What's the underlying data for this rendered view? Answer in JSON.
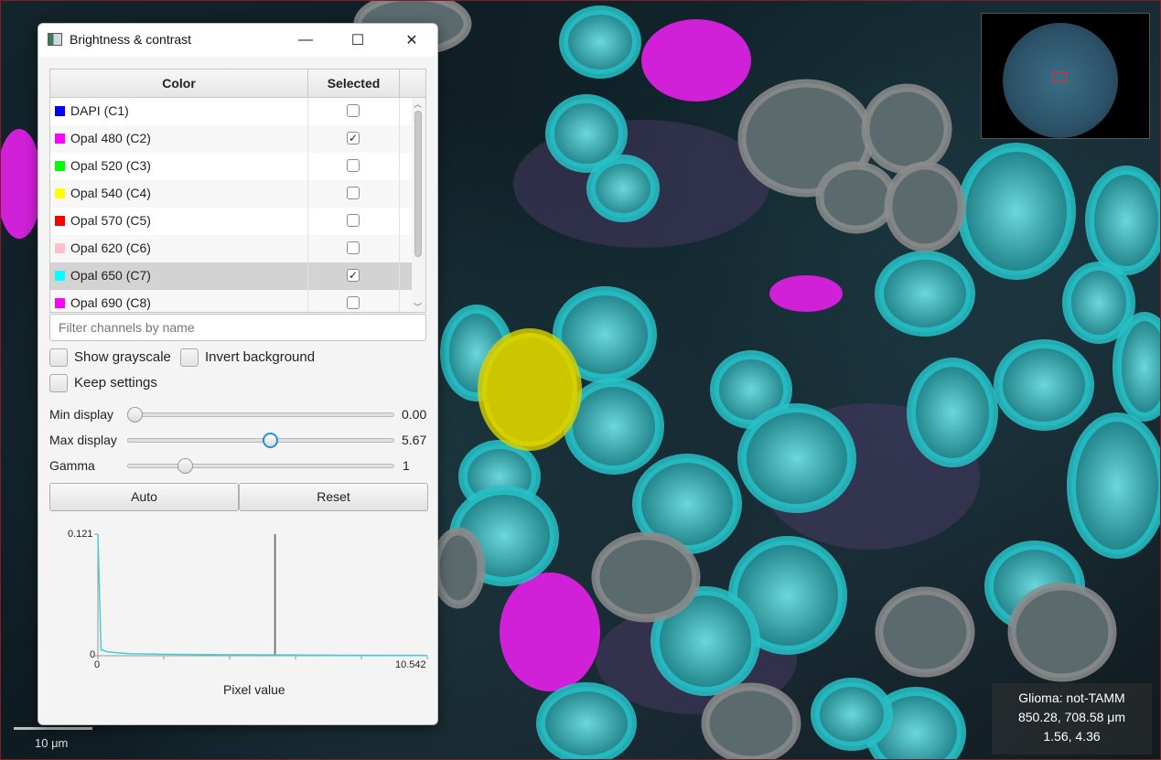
{
  "dialog": {
    "title": "Brightness & contrast",
    "window_controls": {
      "minimize": "—",
      "maximize": "☐",
      "close": "✕"
    },
    "table": {
      "headers": {
        "color": "Color",
        "selected": "Selected"
      },
      "rows": [
        {
          "label": "DAPI (C1)",
          "color": "#0000ff",
          "selected": false
        },
        {
          "label": "Opal 480 (C2)",
          "color": "#ff00ff",
          "selected": true
        },
        {
          "label": "Opal 520 (C3)",
          "color": "#00ff00",
          "selected": false
        },
        {
          "label": "Opal 540 (C4)",
          "color": "#ffff00",
          "selected": false
        },
        {
          "label": "Opal 570 (C5)",
          "color": "#ff0000",
          "selected": false
        },
        {
          "label": "Opal 620 (C6)",
          "color": "#ffc0cb",
          "selected": false
        },
        {
          "label": "Opal 650 (C7)",
          "color": "#00ffff",
          "selected": true,
          "highlighted": true
        },
        {
          "label": "Opal 690 (C8)",
          "color": "#ff00ff",
          "selected": false
        }
      ]
    },
    "filter_placeholder": "Filter channels by name",
    "options": {
      "show_grayscale": "Show grayscale",
      "invert_background": "Invert background",
      "keep_settings": "Keep settings"
    },
    "sliders": {
      "min_display": {
        "label": "Min display",
        "value": "0.00",
        "fraction": 0.0
      },
      "max_display": {
        "label": "Max display",
        "value": "5.67",
        "fraction": 0.538
      },
      "gamma": {
        "label": "Gamma",
        "value": "1",
        "fraction": 0.2
      }
    },
    "buttons": {
      "auto": "Auto",
      "reset": "Reset"
    },
    "histogram": {
      "y_max_label": "0.121",
      "y_min_label": "0",
      "x_min_label": "0",
      "x_max_label": "10.542",
      "xlabel": "Pixel value"
    }
  },
  "viewer": {
    "info": {
      "line1": "Glioma: not-TAMM",
      "line2": "850.28, 708.58 μm",
      "line3": "1.56, 4.36"
    },
    "scalebar_label": "10 μm"
  },
  "chart_data": {
    "type": "line",
    "title": "",
    "xlabel": "Pixel value",
    "ylabel": "",
    "xlim": [
      0,
      10.542
    ],
    "ylim": [
      0,
      0.121
    ],
    "series": [
      {
        "x": [
          0,
          0.1,
          0.3,
          0.6,
          1.0,
          2.0,
          4.0,
          6.0,
          8.0,
          10.542
        ],
        "y": [
          0.121,
          0.006,
          0.004,
          0.003,
          0.002,
          0.0015,
          0.001,
          0.0008,
          0.0005,
          0.0003
        ]
      }
    ],
    "markers": [
      {
        "x": 5.67
      }
    ]
  }
}
